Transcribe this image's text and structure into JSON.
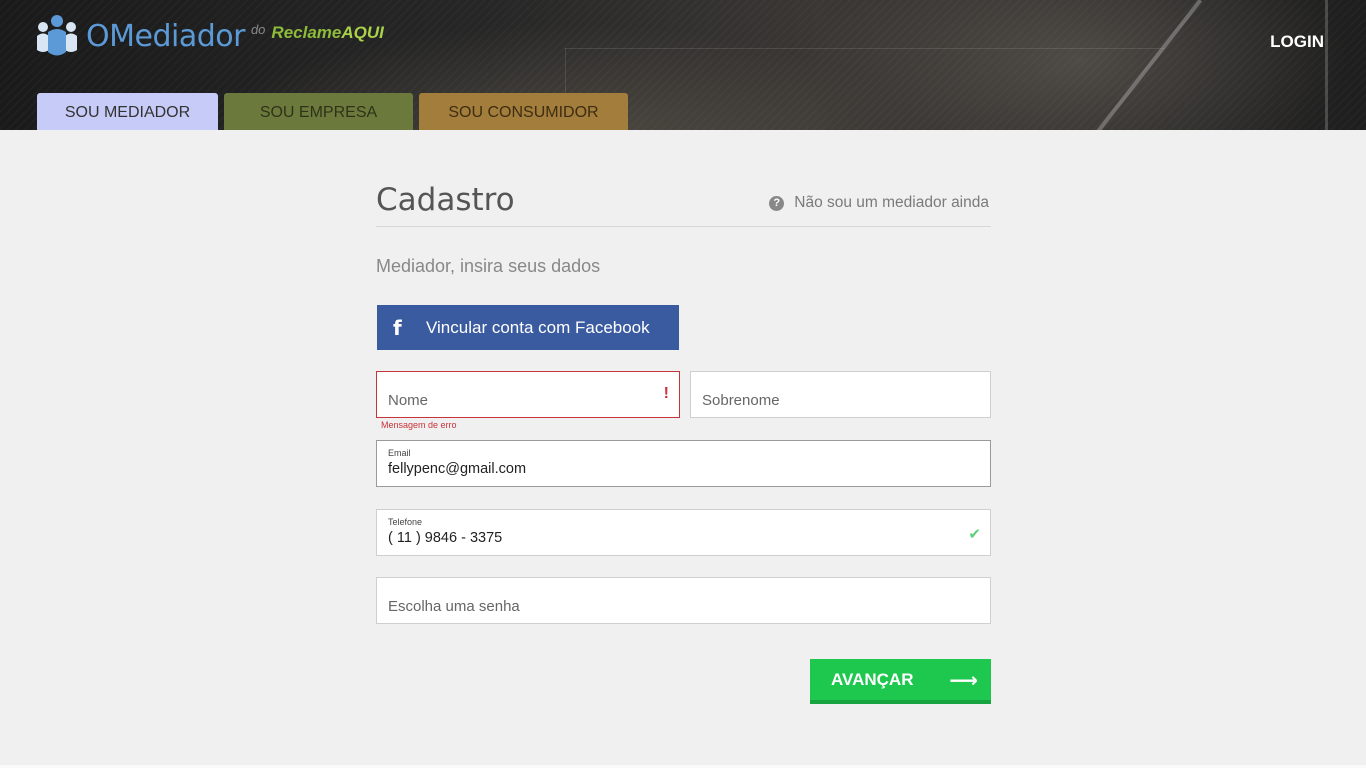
{
  "header": {
    "logo": {
      "brand": "OMediador",
      "connector": "do",
      "partner_a": "Reclame",
      "partner_b": "AQUI"
    },
    "login_label": "LOGIN",
    "tabs": [
      {
        "label": "SOU MEDIADOR",
        "active": true
      },
      {
        "label": "SOU EMPRESA",
        "active": false
      },
      {
        "label": "SOU CONSUMIDOR",
        "active": false
      }
    ]
  },
  "form": {
    "title": "Cadastro",
    "help_link": "Não sou um mediador ainda",
    "subtitle": "Mediador, insira seus dados",
    "facebook_button": "Vincular conta com Facebook",
    "nome": {
      "placeholder": "Nome",
      "error_icon": "!",
      "error_message": "Mensagem de erro"
    },
    "sobrenome": {
      "placeholder": "Sobrenome"
    },
    "email": {
      "label": "Email",
      "value": "fellypenc@gmail.com"
    },
    "telefone": {
      "label": "Telefone",
      "value": "( 11 ) 9846 - 3375"
    },
    "senha": {
      "placeholder": "Escolha uma senha"
    },
    "submit_label": "AVANÇAR"
  },
  "colors": {
    "tab_mediador": "#c6cbf7",
    "tab_empresa": "#6b7a3c",
    "tab_consumidor": "#a27d3b",
    "facebook_blue": "#3b5ba1",
    "submit_green": "#1ec84f",
    "error_red": "#c9333a",
    "valid_green": "#5fd07a"
  },
  "icons": {
    "help": "question-circle-icon",
    "facebook": "facebook-f-icon",
    "error": "exclamation-icon",
    "valid": "checkmark-icon",
    "submit": "arrow-right-icon"
  }
}
